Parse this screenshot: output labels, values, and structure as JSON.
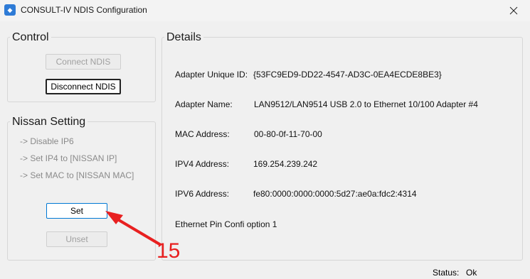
{
  "window": {
    "title": "CONSULT-IV NDIS Configuration",
    "app_icon": "consult-app-icon"
  },
  "control": {
    "title": "Control",
    "connect_label": "Connect NDIS",
    "disconnect_label": "Disconnect NDIS"
  },
  "nissan": {
    "title": "Nissan Setting",
    "steps": [
      "-> Disable IP6",
      "-> Set IP4 to [NISSAN IP]",
      "-> Set MAC to [NISSAN MAC]"
    ],
    "set_label": "Set",
    "unset_label": "Unset"
  },
  "details": {
    "title": "Details",
    "adapter_id_label": "Adapter Unique ID:",
    "adapter_id_value": "{53FC9ED9-DD22-4547-AD3C-0EA4ECDE8BE3}",
    "adapter_name_label": "Adapter Name:",
    "adapter_name_value": "LAN9512/LAN9514 USB 2.0 to Ethernet 10/100 Adapter #4",
    "mac_label": "MAC Address:",
    "mac_value": "00-80-0f-11-70-00",
    "ipv4_label": "IPV4 Address:",
    "ipv4_value": "169.254.239.242",
    "ipv6_label": "IPV6 Address:",
    "ipv6_value": "fe80:0000:0000:0000:5d27:ae0a:fdc2:4314",
    "pin_config": "Ethernet Pin Confi option 1"
  },
  "status": {
    "label": "Status:",
    "value": "Ok"
  },
  "annotation": {
    "number": "15",
    "color": "#e82020"
  }
}
